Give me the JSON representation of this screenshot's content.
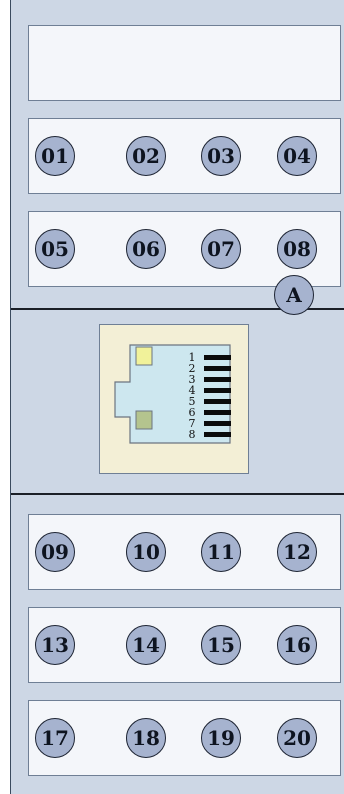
{
  "terminals_top": [
    "01",
    "02",
    "03",
    "04",
    "05",
    "06",
    "07",
    "08"
  ],
  "terminals_bottom": [
    "09",
    "10",
    "11",
    "12",
    "13",
    "14",
    "15",
    "16",
    "17",
    "18",
    "19",
    "20"
  ],
  "rj45": {
    "pins": [
      "1",
      "2",
      "3",
      "4",
      "5",
      "6",
      "7",
      "8"
    ],
    "led_colors": {
      "top": "#f1f29a",
      "bottom": "#b4c48e"
    },
    "socket_color": "#cde7ef"
  },
  "port_a_label": "A",
  "colors": {
    "housing": "#cdd7e5",
    "strip": "#f4f6fa",
    "terminal": "#a6b3cf",
    "divider": "#1b1f27",
    "rj45_panel": "#f3efd6"
  }
}
